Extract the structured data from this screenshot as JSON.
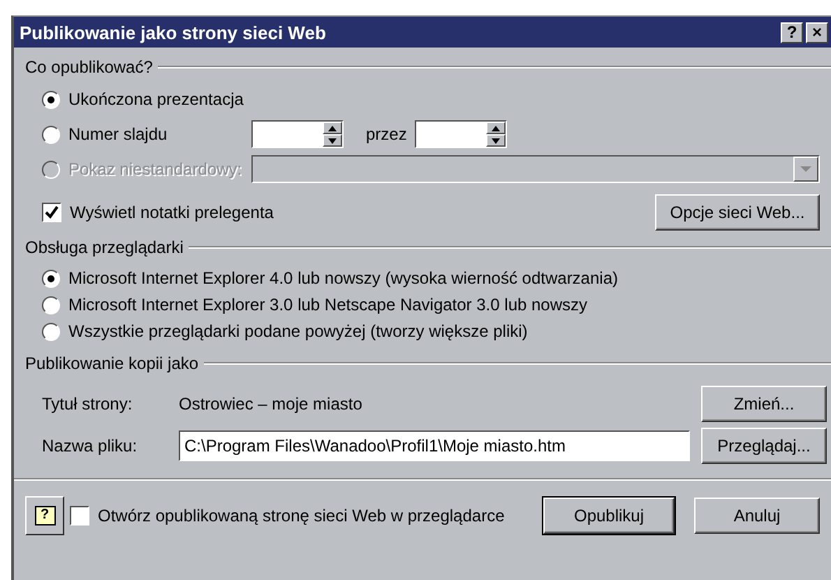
{
  "window": {
    "title": "Publikowanie jako strony sieci Web",
    "help_button": "?",
    "close_button": "×"
  },
  "publish_what": {
    "legend": "Co opublikować?",
    "options": [
      {
        "kind": "plain",
        "label": "Ukończona prezentacja",
        "selected": true,
        "disabled": false
      },
      {
        "kind": "range",
        "label": "Numer slajdu",
        "selected": false,
        "disabled": false,
        "between": "przez"
      },
      {
        "kind": "combo",
        "label": "Pokaz niestandardowy:",
        "selected": false,
        "disabled": true
      }
    ],
    "notes_checkbox": {
      "label": "Wyświetl notatki prelegenta",
      "checked": true
    },
    "web_options_button": "Opcje sieci Web..."
  },
  "browser_support": {
    "legend": "Obsługa przeglądarki",
    "options": [
      {
        "label": "Microsoft Internet Explorer 4.0 lub nowszy (wysoka wierność odtwarzania)",
        "selected": true
      },
      {
        "label": "Microsoft Internet Explorer 3.0 lub Netscape Navigator 3.0 lub nowszy",
        "selected": false
      },
      {
        "label": "Wszystkie przeglądarki podane powyżej (tworzy większe pliki)",
        "selected": false
      }
    ]
  },
  "publish_copy": {
    "legend": "Publikowanie kopii jako",
    "page_title_label": "Tytuł strony:",
    "page_title": "Ostrowiec – moje miasto",
    "change_button": "Zmień...",
    "file_name_label": "Nazwa pliku:",
    "file_name": "C:\\Program Files\\Wanadoo\\Profil1\\Moje miasto.htm",
    "browse_button": "Przeglądaj..."
  },
  "footer": {
    "help_button": "?",
    "open_checkbox": {
      "label": "Otwórz opublikowaną stronę sieci Web w przeglądarce",
      "checked": false
    },
    "publish_button": "Opublikuj",
    "cancel_button": "Anuluj"
  }
}
